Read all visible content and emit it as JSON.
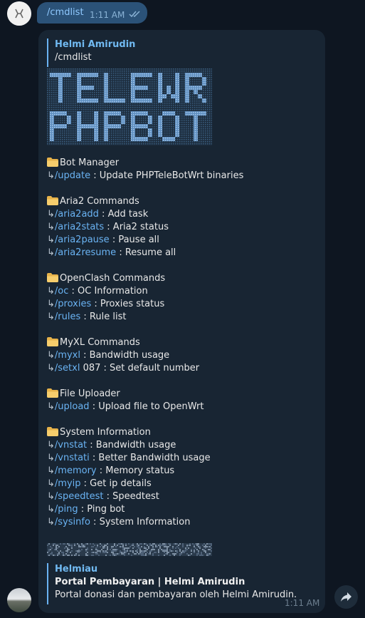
{
  "outgoing": {
    "command": "/cmdlist",
    "time": "1:11 AM",
    "check_icon": "double-check-icon"
  },
  "incoming": {
    "reply": {
      "name": "Helmi Amirudin",
      "text": "/cmdlist"
    },
    "banner_icon": "telewrt-phpbot-ascii-art-banner",
    "sections": [
      {
        "title": "Bot Manager",
        "icon": "folder-icon",
        "items": [
          {
            "arrow": "↳",
            "cmd": "/update",
            "desc": " : Update PHPTeleBotWrt binaries"
          }
        ]
      },
      {
        "title": "Aria2 Commands",
        "icon": "folder-icon",
        "items": [
          {
            "arrow": "↳",
            "cmd": "/aria2add",
            "desc": " : Add task"
          },
          {
            "arrow": "↳",
            "cmd": "/aria2stats",
            "desc": " : Aria2 status"
          },
          {
            "arrow": "↳",
            "cmd": "/aria2pause",
            "desc": " : Pause all"
          },
          {
            "arrow": "↳",
            "cmd": "/aria2resume",
            "desc": " : Resume all"
          }
        ]
      },
      {
        "title": "OpenClash Commands",
        "icon": "folder-icon",
        "items": [
          {
            "arrow": "↳",
            "cmd": "/oc",
            "desc": " : OC Information"
          },
          {
            "arrow": "↳",
            "cmd": "/proxies",
            "desc": " : Proxies status"
          },
          {
            "arrow": "↳",
            "cmd": "/rules",
            "desc": " : Rule list"
          }
        ]
      },
      {
        "title": "MyXL Commands",
        "icon": "folder-icon",
        "items": [
          {
            "arrow": "↳",
            "cmd": "/myxl",
            "desc": " : Bandwidth usage"
          },
          {
            "arrow": "↳",
            "cmd": "/setxl",
            "desc": " 087 : Set default number"
          }
        ]
      },
      {
        "title": "File Uploader",
        "icon": "folder-icon",
        "items": [
          {
            "arrow": "↳",
            "cmd": "/upload",
            "desc": " : Upload file to OpenWrt"
          }
        ]
      },
      {
        "title": "System Information",
        "icon": "folder-icon",
        "items": [
          {
            "arrow": "↳",
            "cmd": "/vnstat",
            "desc": " : Bandwidth usage"
          },
          {
            "arrow": "↳",
            "cmd": "/vnstati",
            "desc": " : Better Bandwidth usage"
          },
          {
            "arrow": "↳",
            "cmd": "/memory",
            "desc": " : Memory status"
          },
          {
            "arrow": "↳",
            "cmd": "/myip",
            "desc": " : Get ip details"
          },
          {
            "arrow": "↳",
            "cmd": "/speedtest",
            "desc": " : Speedtest"
          },
          {
            "arrow": "↳",
            "cmd": "/ping",
            "desc": " : Ping bot"
          },
          {
            "arrow": "↳",
            "cmd": "/sysinfo",
            "desc": " : System Information"
          }
        ]
      }
    ],
    "link_preview": {
      "site": "Helmiau",
      "title": "Portal Pembayaran | Helmi Amirudin",
      "description": "Portal donasi dan pembayaran oleh Helmi Amirudin."
    },
    "time": "1:11 AM",
    "share_icon": "share-icon"
  },
  "colors": {
    "background": "#0e1621",
    "outgoing_bubble": "#2b5278",
    "incoming_bubble": "#182533",
    "link": "#6ab3f3",
    "accent": "#71baf2"
  }
}
